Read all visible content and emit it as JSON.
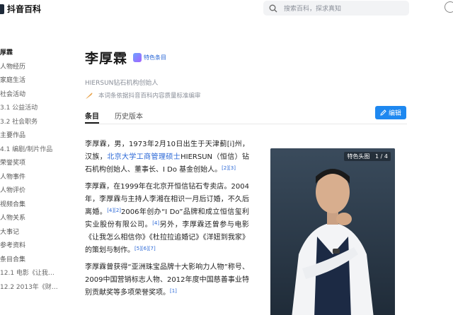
{
  "header": {
    "logo_text": "抖音百科",
    "search_placeholder": "搜索百科，探求真知"
  },
  "toc": [
    {
      "label": "厚霖",
      "active": true
    },
    {
      "label": "人物经历"
    },
    {
      "label": "家庭生活"
    },
    {
      "label": "社会活动"
    },
    {
      "label": "3.1  公益活动",
      "sub": true
    },
    {
      "label": "3.2  社会职务",
      "sub": true
    },
    {
      "label": "主要作品"
    },
    {
      "label": "4.1  编剧/制片作品",
      "sub": true
    },
    {
      "label": "荣誉奖项"
    },
    {
      "label": "人物事件"
    },
    {
      "label": "人物评价"
    },
    {
      "label": "视频合集"
    },
    {
      "label": "人物关系"
    },
    {
      "label": "大事记"
    },
    {
      "label": "参考资料"
    },
    {
      "label": "条目合集"
    },
    {
      "label": "12.1 电影《让我…",
      "sub": true
    },
    {
      "label": "12.2 2013年《财…",
      "sub": true
    }
  ],
  "entry": {
    "title": "李厚霖",
    "badge": "特色条目",
    "subtitle": "HIERSUN钻石机构创始人",
    "notice": "本词条依据抖音百科内容质量标准编审"
  },
  "tabs": [
    "条目",
    "历史版本"
  ],
  "edit_label": "编辑",
  "photo": {
    "caption": "特色头图",
    "counter": "1 / 4"
  },
  "article": {
    "p1_a": "李厚霖，男，1973年2月10日出生于天津蓟[i]州，汉族，",
    "p1_link": "北京大学工商管理硕士",
    "p1_b": "HIERSUN（恒信）钻石机构创始人、董事长、I Do 基金创始人。",
    "p1_ref": "[2][3]",
    "p2_a": "李厚霖，在1999年在北京开恒信钻石专卖店。2004年，李厚霖与主持人李湘在相识一月后订婚，不久后离婚。",
    "p2_ref1": "[4][2]",
    "p2_b": "2006年创办“I Do”品牌和成立恒信玺利实业股份有限公司。",
    "p2_ref2": "[4]",
    "p2_c": "另外，李厚霖还曾参与电影《让我怎么相信你》《杜拉拉追婚记》《洋妞到我家》的策划与制作。",
    "p2_ref3": "[5][6][7]",
    "p3_a": "李厚霖曾获得“亚洲珠宝品牌十大影响力人物”称号、2009中国营销标志人物、2012年度中国慈善事业特别贡献奖等多项荣誉奖项。",
    "p3_ref": "[1]"
  },
  "colors": {
    "accent": "#1e88f0",
    "link": "#2866d6"
  }
}
